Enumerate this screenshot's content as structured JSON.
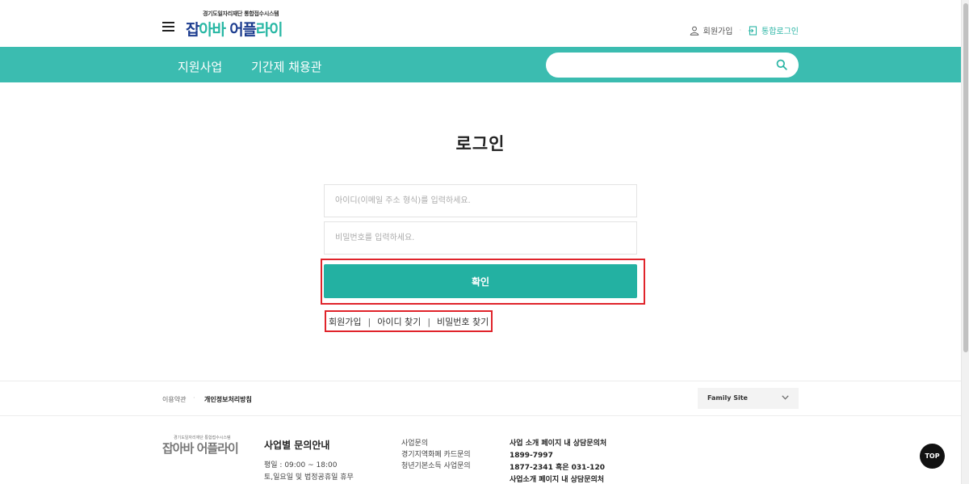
{
  "header": {
    "logo_sub": "경기도일자리재단 통합접수시스템",
    "logo_parts": [
      "잡",
      "아바 ",
      "어플",
      "라이"
    ],
    "signup_label": "회원가입",
    "login_label": "통합로그인"
  },
  "nav": {
    "items": [
      "지원사업",
      "기간제 채용관"
    ],
    "search_placeholder": ""
  },
  "login": {
    "title": "로그인",
    "id_placeholder": "아이디(이메일 주소 형식)를 입력하세요.",
    "pw_placeholder": "비밀번호를 입력하세요.",
    "confirm_label": "확인",
    "links": [
      "회원가입",
      "아이디 찾기",
      "비밀번호 찾기"
    ],
    "separator": "|"
  },
  "footer": {
    "terms_label": "이용약관",
    "privacy_label": "개인정보처리방침",
    "family_site_label": "Family Site",
    "logo_sub": "경기도일자리재단 통합접수시스템",
    "logo_main": "잡아바 어플라이",
    "inquiry_title": "사업별 문의안내",
    "hours": [
      "평일 : 09:00 ~ 18:00",
      "토,일요일 및 법정공휴일 휴무"
    ],
    "col1": [
      "사업문의",
      "경기지역화폐 카드문의",
      "청년기본소득 사업문의"
    ],
    "col2": [
      "사업 소개 페이지 내 상담문의처",
      "1899-7997",
      "1877-2341 혹은 031-120",
      "사업소개 페이지 내 상담문의처"
    ]
  },
  "top_button_label": "TOP",
  "colors": {
    "brand_teal": "#3bbcb0",
    "button_teal": "#23b1a2",
    "logo_navy": "#1d3d8f",
    "highlight_red": "#e0242b"
  }
}
